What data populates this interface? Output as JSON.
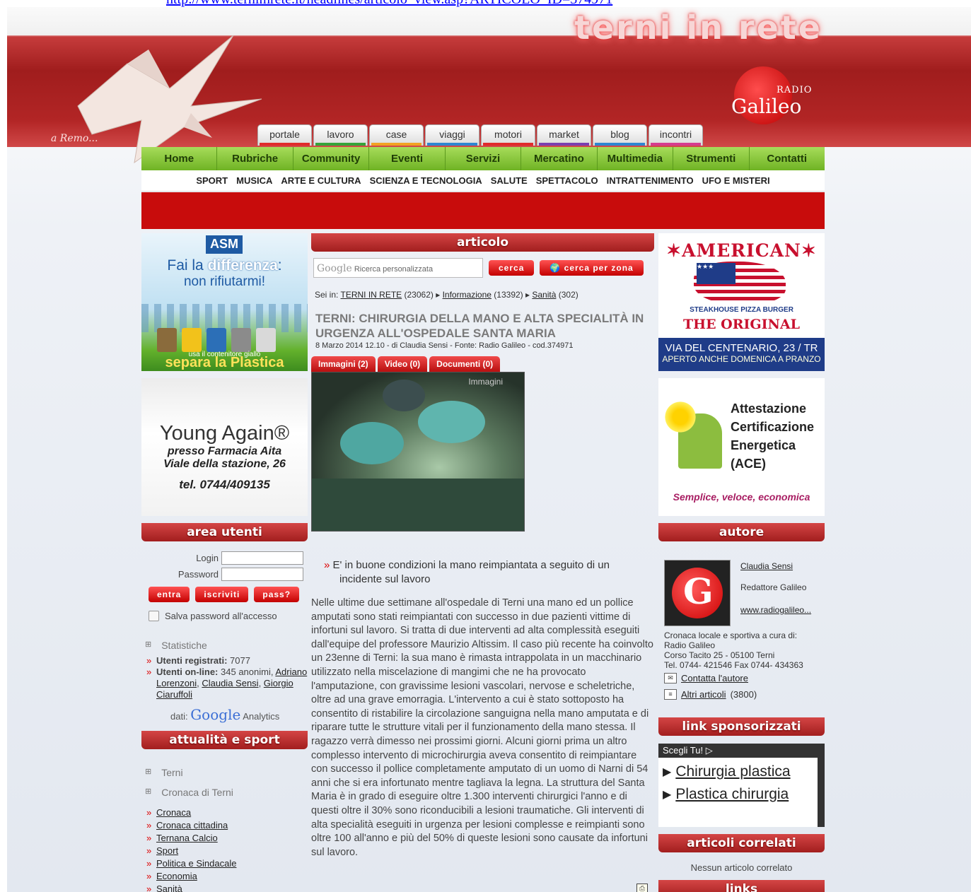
{
  "browser": {
    "url": "http://www.ternimrete.it/headlines/articolo_view.asp?ARTICOLO_ID=374971"
  },
  "header": {
    "site_title": "terni in rete",
    "dedication": "a Remo...",
    "radio_logo_small": "RADIO",
    "radio_logo_name": "Galileo",
    "tabs": [
      {
        "label": "portale",
        "color": "#e02b2b"
      },
      {
        "label": "lavoro",
        "color": "#35a33a"
      },
      {
        "label": "case",
        "color": "#f1a223"
      },
      {
        "label": "viaggi",
        "color": "#2e86d1"
      },
      {
        "label": "motori",
        "color": "#e02b2b"
      },
      {
        "label": "market",
        "color": "#7a3fb0"
      },
      {
        "label": "blog",
        "color": "#2e86d1"
      },
      {
        "label": "incontri",
        "color": "#d63c8f"
      }
    ]
  },
  "nav": {
    "main": [
      "Home",
      "Rubriche",
      "Community",
      "Eventi",
      "Servizi",
      "Mercatino",
      "Multimedia",
      "Strumenti",
      "Contatti"
    ],
    "categories": [
      "SPORT",
      "MUSICA",
      "ARTE E CULTURA",
      "SCIENZA E TECNOLOGIA",
      "SALUTE",
      "SPETTACOLO",
      "INTRATTENIMENTO",
      "UFO E MISTERI"
    ]
  },
  "left": {
    "ad_asm": {
      "logo": "ASM",
      "line1_a": "Fai la",
      "line1_b": "differenza",
      "line1_c": ":",
      "line2": "non rifiutarmi!",
      "line3": "usa il contenitore giallo",
      "line4": "separa la Plastica"
    },
    "ad_young": {
      "title": "Young Again®",
      "line1": "presso Farmacia Aita",
      "line2": "Viale della stazione, 26",
      "phone": "tel. 0744/409135"
    },
    "area_utenti": {
      "title": "area utenti",
      "login_label": "Login",
      "password_label": "Password",
      "btn_enter": "entra",
      "btn_register": "iscriviti",
      "btn_pass": "pass?",
      "save_password": "Salva password all'accesso"
    },
    "stats": {
      "header": "Statistiche",
      "registered_label": "Utenti registrati:",
      "registered_value": "7077",
      "online_label": "Utenti on-line:",
      "online_value": "345 anonimi,",
      "online_users": [
        "Adriano Lorenzoni",
        "Claudia Sensi",
        "Giorgio Ciaruffoli"
      ],
      "ga_prefix": "dati:",
      "ga_google": "Google",
      "ga_suffix": "Analytics"
    },
    "news": {
      "title": "attualità e sport",
      "group1": "Terni",
      "group2": "Cronaca di Terni",
      "links": [
        "Cronaca",
        "Cronaca cittadina",
        "Ternana Calcio",
        "Sport",
        "Politica e Sindacale",
        "Economia",
        "Sanità"
      ]
    }
  },
  "article": {
    "section_title": "articolo",
    "search_brand": "Google",
    "search_placeholder": "Ricerca personalizzata",
    "btn_search": "cerca",
    "btn_search_zone": "cerca per zona",
    "breadcrumb_prefix": "Sei in:",
    "breadcrumb": [
      {
        "label": "TERNI IN RETE",
        "count": "(23062)"
      },
      {
        "label": "Informazione",
        "count": "(13392)"
      },
      {
        "label": "Sanità",
        "count": "(302)"
      }
    ],
    "title": "TERNI: CHIRURGIA DELLA MANO E ALTA SPECIALITÀ IN URGENZA ALL'OSPEDALE SANTA MARIA",
    "meta": "8 Marzo 2014 12.10 - di Claudia Sensi - Fonte: Radio Galileo - cod.374971",
    "tabs": [
      "Immagini (2)",
      "Video (0)",
      "Documenti (0)"
    ],
    "photo_label": "Immagini",
    "lead": "E' in buone condizioni la mano reimpiantata a seguito di un incidente sul lavoro",
    "body": "Nelle ultime due settimane all'ospedale di Terni una mano ed un pollice amputati sono stati reimpiantati con successo in due pazienti vittime di infortuni sul lavoro. Si tratta di due interventi ad alta complessità eseguiti dall'equipe del professore Maurizio Altissim. Il caso più recente ha coinvolto un 23enne di Terni: la sua mano è rimasta intrappolata in un macchinario utilizzato nella miscelazione di mangimi che ne ha provocato l'amputazione, con gravissime lesioni vascolari, nervose e scheletriche, oltre ad una grave emorragia. L'intervento a cui è stato sottoposto ha consentito di ristabilire la circolazione sanguigna nella mano amputata e di riparare tutte le strutture vitali per il funzionamento della mano stessa. Il ragazzo verrà dimesso nei prossimi giorni. Alcuni giorni prima un altro complesso intervento di microchirurgia aveva consentito di reimpiantare con successo il pollice completamente amputato di un uomo di Narni di 54 anni che si era infortunato mentre tagliava la legna. La struttura del Santa Maria è in grado di eseguire oltre 1.300 interventi chirurgici l'anno e di questi oltre il 30% sono riconducibili a lesioni traumatiche. Gli interventi di alta specialità eseguiti in urgenza per lesioni complesse e reimpianti sono oltre 100 all'anno e più del 50% di queste lesioni sono causate da infortuni sul lavoro."
  },
  "right": {
    "ad_american": {
      "title": "AMERICAN",
      "sub": "STEAKHOUSE PIZZA BURGER",
      "original": "THE ORIGINAL",
      "address": "VIA DEL CENTENARIO, 23 / TR",
      "open": "APERTO ANCHE DOMENICA A PRANZO"
    },
    "ad_ace": {
      "lines": [
        "Attestazione",
        "Certificazione",
        "Energetica",
        "(ACE)"
      ],
      "slogan": "Semplice, veloce, economica"
    },
    "autore": {
      "title": "autore",
      "name": "Claudia Sensi",
      "role": "Redattore Galileo",
      "web": "www.radiogalileo...",
      "desc1": "Cronaca locale e sportiva a cura di:",
      "desc2": "Radio Galileo",
      "desc3": "Corso Tacito 25 - 05100 Terni",
      "desc4": "Tel. 0744- 421546 Fax 0744- 434363",
      "contact": "Contatta l'autore",
      "other_articles": "Altri articoli",
      "other_count": "(3800)"
    },
    "sponsored": {
      "title": "link sponsorizzati",
      "bar": "Scegli Tu!",
      "links": [
        "Chirurgia plastica",
        "Plastica chirurgia"
      ]
    },
    "related": {
      "title": "articoli correlati",
      "empty": "Nessun articolo correlato"
    },
    "links": {
      "title": "links"
    }
  }
}
